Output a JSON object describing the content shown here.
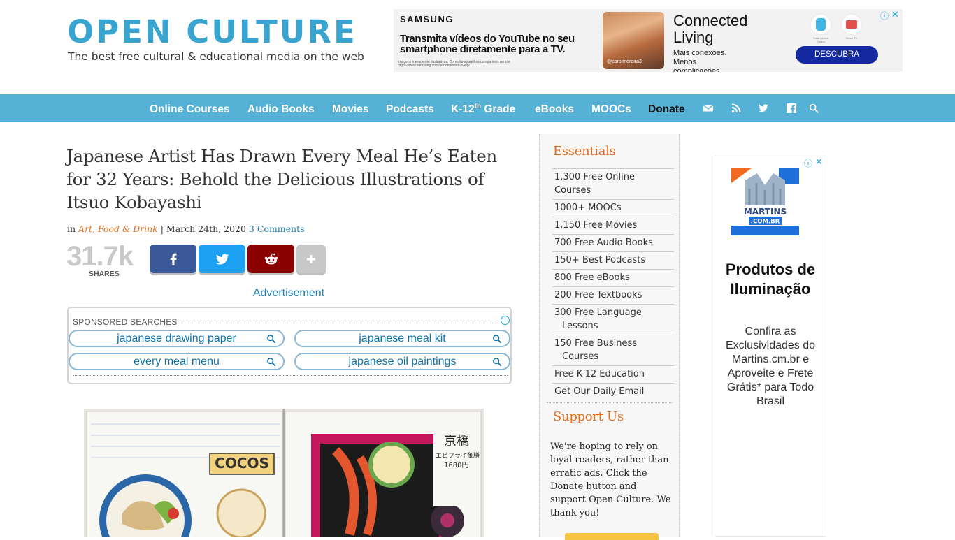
{
  "header": {
    "logo": "OPEN CULTURE",
    "tagline": "The best free cultural & educational media on the web"
  },
  "top_ad": {
    "brand": "SAMSUNG",
    "headline": "Transmita vídeos do YouTube no seu smartphone diretamente para a TV.",
    "fine_print": "Imagens meramente ilustrativas. Consulte aparelhos compatíveis no site https://www.samsung.com/br/connected-living/",
    "photo_tag": "@carolmoreira3",
    "title": "Connected Living",
    "subtitle": "Mais conexões. Menos complicações.",
    "device_1": "Smartphone Galaxy",
    "device_2": "Smart TV",
    "cta": "DESCUBRA",
    "accent_color": "#1428a0"
  },
  "nav": {
    "items": [
      {
        "label": "Online Courses"
      },
      {
        "label": "Audio Books"
      },
      {
        "label": "Movies"
      },
      {
        "label": "Podcasts"
      },
      {
        "label": "K-12",
        "sup": "th",
        "suffix": " Grade"
      },
      {
        "label": "eBooks"
      },
      {
        "label": "MOOCs"
      },
      {
        "label": "Donate"
      }
    ],
    "icons": [
      "mail-icon",
      "rss-icon",
      "twitter-icon",
      "facebook-icon",
      "search-icon"
    ],
    "bar_color": "#55b1d6"
  },
  "article": {
    "title": "Japanese Artist Has Drawn Every Meal He’s Eaten for 32 Years: Behold the Delicious Illustrations of Itsuo Kobayashi",
    "meta_in": "in",
    "category": "Art, Food & Drink",
    "date": "| March 24th, 2020",
    "comments": "3 Comments",
    "share_count": "31.7k",
    "share_label": "SHARES",
    "share_buttons": [
      {
        "name": "facebook",
        "color": "#3b5998"
      },
      {
        "name": "twitter",
        "color": "#1da1f2"
      },
      {
        "name": "reddit",
        "color": "#8b0000"
      },
      {
        "name": "more",
        "color": "#c8c8c8"
      }
    ],
    "advertisement_label": "Advertisement",
    "image_text": [
      "COCOS",
      "京橋",
      "エビフライ御膳",
      "1680円"
    ]
  },
  "sponsored": {
    "title": "SPONSORED SEARCHES",
    "info": "i",
    "searches": [
      "japanese drawing paper",
      "japanese meal kit",
      "every meal menu",
      "japanese oil paintings"
    ]
  },
  "sidebar": {
    "essentials_title": "Essentials",
    "essentials": [
      "1,300 Free Online Courses",
      "1000+ MOOCs",
      "1,150 Free Movies",
      "700 Free Audio Books",
      "150+ Best Podcasts",
      "800 Free eBooks",
      "200 Free Textbooks",
      "300 Free Language",
      "Lessons",
      "150 Free Business",
      "Courses",
      "Free K-12 Education",
      "Get Our Daily Email"
    ],
    "support_title": "Support Us",
    "support_text": "We're hoping to rely on loyal readers, rather than erratic ads. Click the Donate button and support Open Culture. We thank you!"
  },
  "right_ad": {
    "logo_text": "MARTINS",
    "logo_sub": ".COM.BR",
    "title": "Produtos de Iluminação",
    "body": "Confira as Exclusividades do Martins.cm.br e Aproveite e Frete Grátis* para Todo Brasil"
  }
}
